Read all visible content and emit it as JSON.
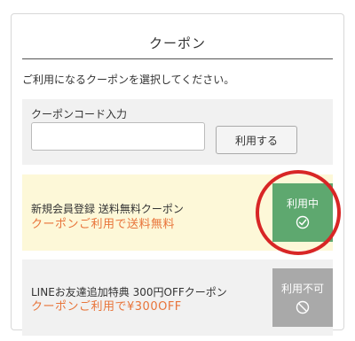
{
  "panel": {
    "title": "クーポン",
    "instruction": "ご利用になるクーポンを選択してください。"
  },
  "code_entry": {
    "label": "クーポンコード入力",
    "input_value": "",
    "input_placeholder": "",
    "apply_label": "利用する"
  },
  "coupons": [
    {
      "name": "新規会員登録 送料無料クーポン",
      "description": "クーポンご利用で送料無料",
      "status_label": "利用中",
      "status_icon": "check-circle-icon",
      "status": "in-use"
    },
    {
      "name": "LINEお友達追加特典 300円OFFクーポン",
      "description": "クーポンご利用で¥300OFF",
      "status_label": "利用不可",
      "status_icon": "prohibited-icon",
      "status": "unavailable"
    }
  ],
  "colors": {
    "accent_orange": "#e8743a",
    "in_use_green": "#5ea86f",
    "disabled_gray": "#a9a9a9",
    "highlight_yellow": "#fdf8d8",
    "annotation_red": "#d82626"
  }
}
